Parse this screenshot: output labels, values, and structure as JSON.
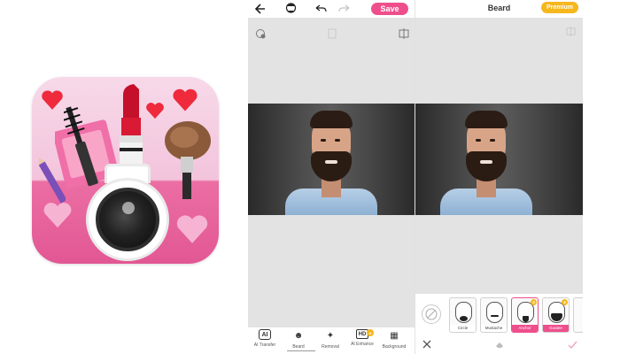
{
  "app_icon": {
    "name": "YouCam Makeup app icon"
  },
  "screen_a": {
    "toolbar": {
      "back_icon": "arrow-left-icon",
      "avatar_icon": "face-avatar-icon",
      "undo_icon": "undo-icon",
      "redo_icon": "redo-icon",
      "save_label": "Save"
    },
    "tools": [
      {
        "label": "AI Transfer",
        "icon": "ai-transfer-icon",
        "glyph": "AI"
      },
      {
        "label": "Beard",
        "icon": "beard-icon",
        "glyph": "☻"
      },
      {
        "label": "Removal",
        "icon": "magic-wand-icon",
        "glyph": "✦"
      },
      {
        "label": "AI Enhance",
        "icon": "hd-icon",
        "glyph": "HD"
      },
      {
        "label": "Background",
        "icon": "background-icon",
        "glyph": "▦"
      }
    ]
  },
  "screen_b": {
    "title": "Beard",
    "premium_label": "Premium",
    "beard_options": [
      {
        "label": "Circle",
        "premium": false
      },
      {
        "label": "Mustache",
        "premium": false
      },
      {
        "label": "Anchor",
        "premium": true
      },
      {
        "label": "Goatee",
        "premium": true
      }
    ],
    "cancel_icon": "close-icon",
    "eraser_icon": "eraser-icon",
    "confirm_icon": "check-icon"
  },
  "colors": {
    "accent_pink": "#ee4f8c",
    "premium_gold": "#f6b71d"
  }
}
